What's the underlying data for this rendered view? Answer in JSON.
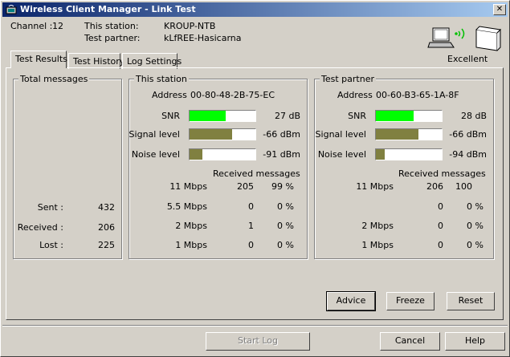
{
  "window": {
    "title": "Wireless Client Manager - Link Test"
  },
  "header": {
    "channel_label": "Channel :",
    "channel_value": "12",
    "station_label": "This station:",
    "station_value": "KROUP-NTB",
    "partner_label": "Test partner:",
    "partner_value": "kLfREE-Hasicarna",
    "quality": "Excellent"
  },
  "tabs": [
    {
      "label": "Test Results",
      "active": true
    },
    {
      "label": "Test History",
      "active": false
    },
    {
      "label": "Log Settings",
      "active": false
    }
  ],
  "total": {
    "title": "Total messages",
    "sent_label": "Sent :",
    "sent_value": "432",
    "received_label": "Received :",
    "received_value": "206",
    "lost_label": "Lost :",
    "lost_value": "225"
  },
  "this_station": {
    "title": "This station",
    "address_label": "Address",
    "address_value": "00-80-48-2B-75-EC",
    "snr_label": "SNR",
    "snr_value": "27 dB",
    "snr_fill": 0.55,
    "signal_label": "Signal level",
    "signal_value": "-66 dBm",
    "signal_fill": 0.65,
    "noise_label": "Noise level",
    "noise_value": "-91 dBm",
    "noise_fill": 0.2,
    "received_header": "Received messages",
    "rates": [
      {
        "rate": "11 Mbps",
        "count": "205",
        "pct": "99 %"
      },
      {
        "rate": "5.5 Mbps",
        "count": "0",
        "pct": "0 %"
      },
      {
        "rate": "2 Mbps",
        "count": "1",
        "pct": "0 %"
      },
      {
        "rate": "1 Mbps",
        "count": "0",
        "pct": "0 %"
      }
    ]
  },
  "test_partner": {
    "title": "Test partner",
    "address_label": "Address",
    "address_value": "00-60-B3-65-1A-8F",
    "snr_label": "SNR",
    "snr_value": "28 dB",
    "snr_fill": 0.57,
    "signal_label": "Signal level",
    "signal_value": "-66 dBm",
    "signal_fill": 0.65,
    "noise_label": "Noise level",
    "noise_value": "-94 dBm",
    "noise_fill": 0.14,
    "received_header": "Received messages",
    "rates": [
      {
        "rate": "11 Mbps",
        "count": "206",
        "pct": "100"
      },
      {
        "rate": "",
        "count": "0",
        "pct": "0 %"
      },
      {
        "rate": "2 Mbps",
        "count": "0",
        "pct": "0 %"
      },
      {
        "rate": "1 Mbps",
        "count": "0",
        "pct": "0 %"
      }
    ]
  },
  "buttons": {
    "advice": "Advice",
    "freeze": "Freeze",
    "reset": "Reset",
    "start_log": "Start Log",
    "cancel": "Cancel",
    "help": "Help"
  },
  "colors": {
    "snr_green": "#00ff00",
    "level_olive": "#808040",
    "title_blue": "#0a246a"
  }
}
